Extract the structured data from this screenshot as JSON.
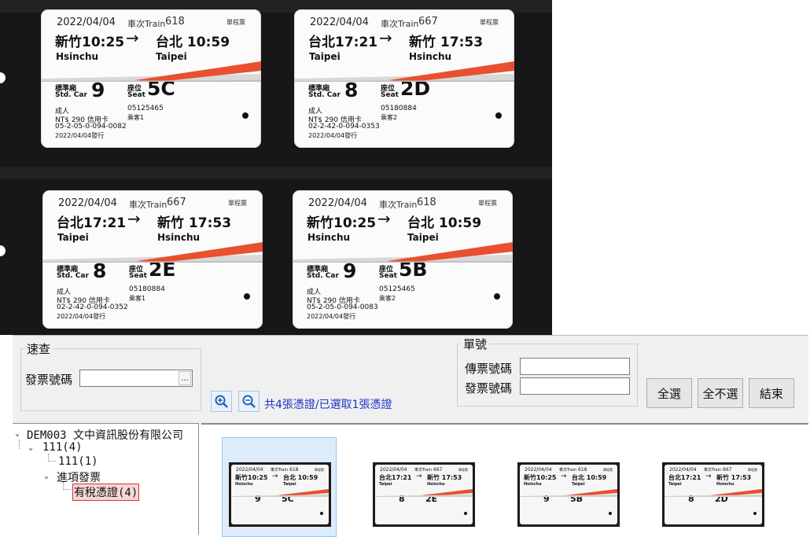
{
  "tickets": [
    {
      "date": "2022/04/04",
      "train_label": "車次Train",
      "train_no": "618",
      "single": "單程票",
      "from_zh": "新竹10:25",
      "from_en": "Hsinchu",
      "arrow": "→",
      "to_zh": "台北 10:59",
      "to_en": "Taipei",
      "car_zh": "標準廂",
      "car_en": "Std. Car",
      "car_no": "9",
      "seat_zh": "座位",
      "seat_en": "Seat",
      "seat_no": "5C",
      "line1": "成人",
      "line2": "NT$ 290  信用卡",
      "line3": "05-2-05-0-094-0082",
      "line4": "2022/04/04發行",
      "code": "05125465",
      "pax": "乘客1"
    },
    {
      "date": "2022/04/04",
      "train_label": "車次Train",
      "train_no": "667",
      "single": "單程票",
      "from_zh": "台北17:21",
      "from_en": "Taipei",
      "arrow": "→",
      "to_zh": "新竹 17:53",
      "to_en": "Hsinchu",
      "car_zh": "標準廂",
      "car_en": "Std. Car",
      "car_no": "8",
      "seat_zh": "座位",
      "seat_en": "Seat",
      "seat_no": "2D",
      "line1": "成人",
      "line2": "NT$ 290  信用卡",
      "line3": "02-2-42-0-094-0353",
      "line4": "2022/04/04發行",
      "code": "05180884",
      "pax": "乘客2"
    },
    {
      "date": "2022/04/04",
      "train_label": "車次Train",
      "train_no": "667",
      "single": "單程票",
      "from_zh": "台北17:21",
      "from_en": "Taipei",
      "arrow": "→",
      "to_zh": "新竹 17:53",
      "to_en": "Hsinchu",
      "car_zh": "標準廂",
      "car_en": "Std. Car",
      "car_no": "8",
      "seat_zh": "座位",
      "seat_en": "Seat",
      "seat_no": "2E",
      "line1": "成人",
      "line2": "NT$ 290  信用卡",
      "line3": "02-2-42-0-094-0352",
      "line4": "2022/04/04發行",
      "code": "05180884",
      "pax": "乘客1"
    },
    {
      "date": "2022/04/04",
      "train_label": "車次Train",
      "train_no": "618",
      "single": "單程票",
      "from_zh": "新竹10:25",
      "from_en": "Hsinchu",
      "arrow": "→",
      "to_zh": "台北 10:59",
      "to_en": "Taipei",
      "car_zh": "標準廂",
      "car_en": "Std. Car",
      "car_no": "9",
      "seat_zh": "座位",
      "seat_en": "Seat",
      "seat_no": "5B",
      "line1": "成人",
      "line2": "NT$ 290  信用卡",
      "line3": "05-2-05-0-094-0083",
      "line4": "2022/04/04發行",
      "code": "05125465",
      "pax": "乘客2"
    }
  ],
  "quick_search": {
    "legend": "速查",
    "invoice_label": "發票號碼",
    "invoice_value": "",
    "browse": "..."
  },
  "doc_no": {
    "legend": "單號",
    "fax_label": "傳票號碼",
    "fax_value": "",
    "invoice_label": "發票號碼",
    "invoice_value": ""
  },
  "zoom_in_icon": "zoom-in",
  "zoom_out_icon": "zoom-out",
  "status_text": "共4張憑證/已選取1張憑證",
  "buttons": {
    "select_all": "全選",
    "select_none": "全不選",
    "end": "結束"
  },
  "tree": {
    "root": "DEM003 文中資訊股份有限公司",
    "year": "111(4)",
    "period": "111(1)",
    "category": "進項發票",
    "leaf": "有稅憑證(4)"
  },
  "thumbs": [
    {
      "train_no": "618",
      "from_zh": "新竹10:25",
      "from_en": "Hsinchu",
      "to_zh": "台北 10:59",
      "to_en": "Taipei",
      "car_no": "9",
      "seat_no": "5C",
      "selected": "true"
    },
    {
      "train_no": "667",
      "from_zh": "台北17:21",
      "from_en": "Taipei",
      "to_zh": "新竹 17:53",
      "to_en": "Hsinchu",
      "car_no": "8",
      "seat_no": "2E",
      "selected": "false"
    },
    {
      "train_no": "618",
      "from_zh": "新竹10:25",
      "from_en": "Hsinchu",
      "to_zh": "台北 10:59",
      "to_en": "Taipei",
      "car_no": "9",
      "seat_no": "5B",
      "selected": "false"
    },
    {
      "train_no": "667",
      "from_zh": "台北17:21",
      "from_en": "Taipei",
      "to_zh": "新竹 17:53",
      "to_en": "Hsinchu",
      "car_no": "8",
      "seat_no": "2D",
      "selected": "false"
    }
  ],
  "thumb_date": "2022/04/04",
  "thumb_train_label": "車次Train",
  "thumb_single": "單程票",
  "colors": {
    "accent_red": "#e8502f",
    "status_blue": "#1b33c8",
    "selected_bg": "#dcecfb"
  }
}
